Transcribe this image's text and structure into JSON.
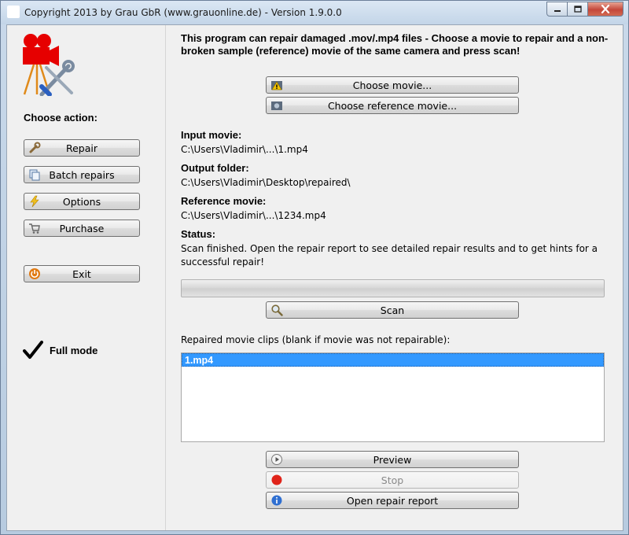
{
  "window": {
    "title": "Copyright 2013 by Grau GbR (www.grauonline.de) - Version 1.9.0.0",
    "controls": {
      "minimize": "▭",
      "maximize": "▢",
      "close": "✕"
    }
  },
  "sidebar": {
    "choose_action": "Choose action:",
    "buttons": {
      "repair": "Repair",
      "batch": "Batch repairs",
      "options": "Options",
      "purchase": "Purchase",
      "exit": "Exit"
    },
    "mode": "Full mode"
  },
  "main": {
    "intro": "This program can repair damaged .mov/.mp4 files - Choose a movie to repair and a non-broken sample (reference) movie of the same camera and press scan!",
    "choose_movie": "Choose movie...",
    "choose_reference": "Choose reference movie...",
    "input_label": "Input movie:",
    "input_value": "C:\\Users\\Vladimir\\...\\1.mp4",
    "output_label": "Output folder:",
    "output_value": "C:\\Users\\Vladimir\\Desktop\\repaired\\",
    "reference_label": "Reference movie:",
    "reference_value": "C:\\Users\\Vladimir\\...\\1234.mp4",
    "status_label": "Status:",
    "status_value": "Scan finished. Open the repair report to see detailed repair results and to get hints for a successful repair!",
    "progress_percent": 0,
    "scan": "Scan",
    "clips_label": "Repaired movie clips (blank if movie was not repairable):",
    "clips": [
      "1.mp4"
    ],
    "preview": "Preview",
    "stop": "Stop",
    "open_report": "Open repair report"
  },
  "colors": {
    "selection": "#3399ff",
    "exit_icon": "#e07a12",
    "stop_icon": "#e0241a",
    "info_icon": "#2f6fd1"
  }
}
